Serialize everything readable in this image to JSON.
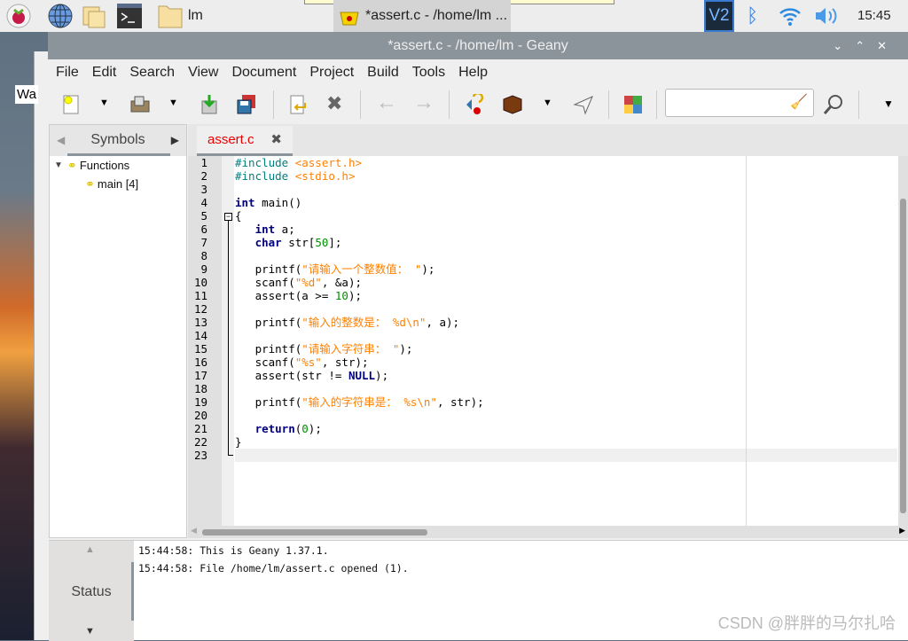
{
  "taskbar": {
    "folder_label": "lm",
    "task_label": "*assert.c - /home/lm ...",
    "clock": "15:45",
    "icons": [
      "raspberry-menu-icon",
      "browser-globe-icon",
      "file-manager-icon",
      "terminal-icon",
      "folder-icon"
    ],
    "tray": [
      "vnc-icon",
      "bluetooth-icon",
      "wifi-icon",
      "volume-icon"
    ]
  },
  "desktop": {
    "partial_window_text": "Wa"
  },
  "window": {
    "title": "*assert.c - /home/lm - Geany"
  },
  "menu": [
    "File",
    "Edit",
    "Search",
    "View",
    "Document",
    "Project",
    "Build",
    "Tools",
    "Help"
  ],
  "toolbar": {
    "search_value": "",
    "icons": [
      "new-file",
      "open-file",
      "save",
      "save-all",
      "revert",
      "close",
      "back",
      "forward",
      "compile",
      "build",
      "run",
      "color-chooser",
      "search",
      "overflow"
    ]
  },
  "sidebar": {
    "tab": "Symbols",
    "tree": [
      {
        "label": "Functions",
        "children": [
          {
            "label": "main [4]"
          }
        ]
      }
    ]
  },
  "editor": {
    "tab_label": "assert.c",
    "current_line": 23,
    "lines": [
      [
        [
          "pp",
          "#include "
        ],
        [
          "str",
          "<assert.h>"
        ]
      ],
      [
        [
          "pp",
          "#include "
        ],
        [
          "str",
          "<stdio.h>"
        ]
      ],
      [],
      [
        [
          "kw",
          "int"
        ],
        [
          "",
          "  main()"
        ]
      ],
      [
        [
          "",
          "{"
        ]
      ],
      [
        [
          "",
          "    "
        ],
        [
          "kw",
          "int"
        ],
        [
          "",
          "  a;"
        ]
      ],
      [
        [
          "",
          "    "
        ],
        [
          "kw",
          "char"
        ],
        [
          "",
          "  str["
        ],
        [
          "num",
          "50"
        ],
        [
          "",
          "];"
        ]
      ],
      [],
      [
        [
          "",
          "    printf("
        ],
        [
          "str",
          "\"请输入一个整数值： \""
        ],
        [
          "",
          ");"
        ]
      ],
      [
        [
          "",
          "    scanf("
        ],
        [
          "str",
          "\"%d\""
        ],
        [
          "",
          ", &a);"
        ]
      ],
      [
        [
          "",
          "    assert(a >= "
        ],
        [
          "num",
          "10"
        ],
        [
          "",
          ");"
        ]
      ],
      [],
      [
        [
          "",
          "    printf("
        ],
        [
          "str",
          "\"输入的整数是： %d\\n\""
        ],
        [
          "",
          ", a);"
        ]
      ],
      [],
      [
        [
          "",
          "    printf("
        ],
        [
          "str",
          "\"请输入字符串： \""
        ],
        [
          "",
          ");"
        ]
      ],
      [
        [
          "",
          "    scanf("
        ],
        [
          "str",
          "\"%s\""
        ],
        [
          "",
          ", str);"
        ]
      ],
      [
        [
          "",
          "    assert(str != "
        ],
        [
          "kw",
          "NULL"
        ],
        [
          "",
          ");"
        ]
      ],
      [],
      [
        [
          "",
          "    printf("
        ],
        [
          "str",
          "\"输入的字符串是： %s\\n\""
        ],
        [
          "",
          ", str);"
        ]
      ],
      [],
      [
        [
          "",
          "    "
        ],
        [
          "kw",
          "return"
        ],
        [
          "",
          "("
        ],
        [
          "num",
          "0"
        ],
        [
          "",
          ");"
        ]
      ],
      [
        [
          "",
          "}"
        ]
      ],
      []
    ]
  },
  "messages": {
    "tab": "Status",
    "lines": [
      "15:44:58: This is Geany 1.37.1.",
      "15:44:58: File /home/lm/assert.c opened (1)."
    ]
  },
  "watermark": "CSDN @胖胖的马尔扎哈"
}
